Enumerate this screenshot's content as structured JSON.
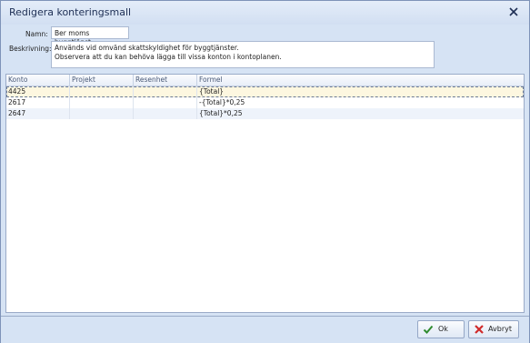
{
  "window": {
    "title": "Redigera konteringsmall"
  },
  "form": {
    "name_label": "Namn:",
    "name_value": "Ber moms byggtjänst",
    "desc_label": "Beskrivning:",
    "desc_line1": "Används vid omvänd skattskyldighet för byggtjänster.",
    "desc_line2": "Observera att du kan behöva lägga till vissa konton i kontoplanen."
  },
  "grid": {
    "headers": [
      "Konto",
      "Projekt",
      "Resenhet",
      "Formel"
    ],
    "rows": [
      {
        "konto": "4425",
        "projekt": "",
        "resenhet": "",
        "formel": "{Total}"
      },
      {
        "konto": "2617",
        "projekt": "",
        "resenhet": "",
        "formel": "-{Total}*0,25"
      },
      {
        "konto": "2647",
        "projekt": "",
        "resenhet": "",
        "formel": "{Total}*0,25"
      }
    ]
  },
  "buttons": {
    "ok": "Ok",
    "cancel": "Avbryt"
  },
  "colors": {
    "accent": "#d6e3f4",
    "selected_row": "#fdf7e0",
    "alt_row": "#eef3fb"
  },
  "icons": {
    "close": "close-icon",
    "ok": "checkmark-icon",
    "cancel": "red-x-icon"
  }
}
